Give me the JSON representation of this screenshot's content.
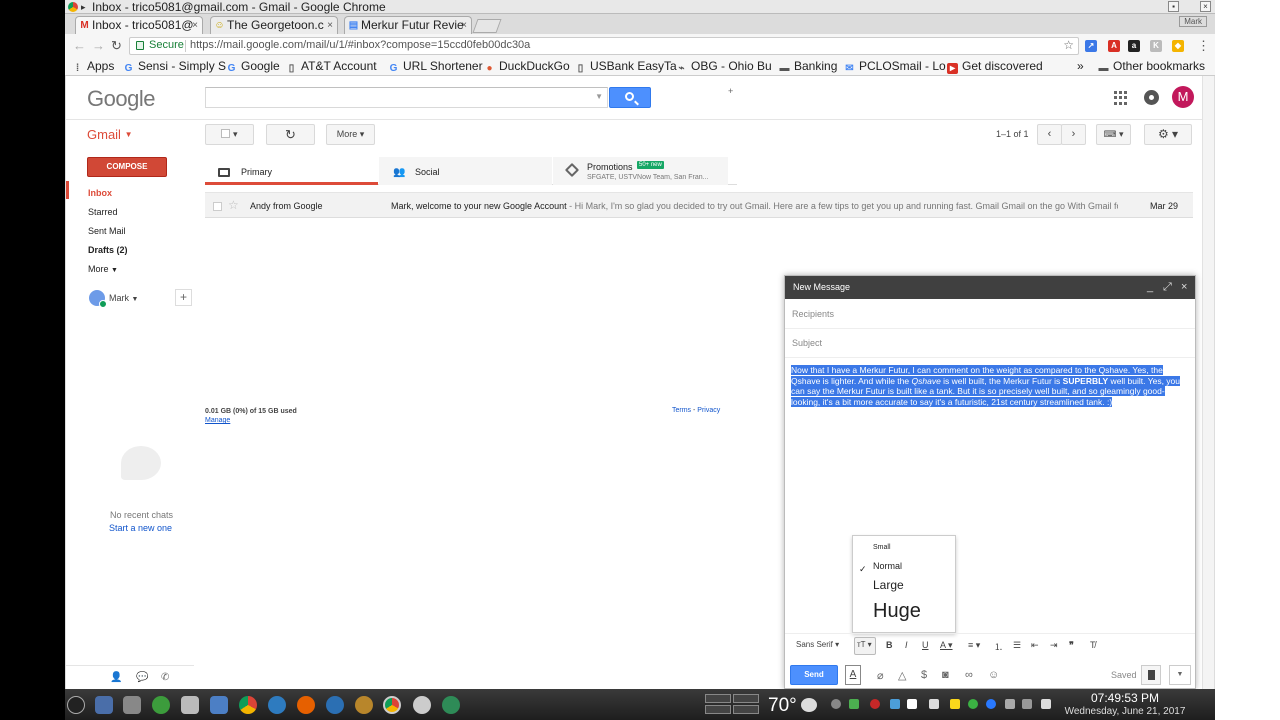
{
  "window": {
    "title": "Inbox - trico5081@gmail.com - Gmail - Google Chrome",
    "profile": "Mark"
  },
  "tabs": [
    {
      "label": "Inbox - trico5081@",
      "favicon": "gmail-icon",
      "active": true
    },
    {
      "label": "The Georgetoon.c",
      "favicon": "georgetoon-icon",
      "active": false
    },
    {
      "label": "Merkur Futur Revie",
      "favicon": "document-icon",
      "active": false
    }
  ],
  "omnibox": {
    "secure_label": "Secure",
    "url": "https://mail.google.com/mail/u/1/#inbox?compose=15ccd0feb00dc30a"
  },
  "bookmarks": [
    {
      "label": "Apps",
      "icon": "apps-grid-icon"
    },
    {
      "label": "Sensi - Simply S",
      "icon": "google-icon"
    },
    {
      "label": "Google",
      "icon": "google-icon"
    },
    {
      "label": "AT&T Account",
      "icon": "page-icon"
    },
    {
      "label": "URL Shortener",
      "icon": "google-icon"
    },
    {
      "label": "DuckDuckGo",
      "icon": "duckduckgo-icon"
    },
    {
      "label": "USBank EasyTa",
      "icon": "page-icon"
    },
    {
      "label": "OBG - Ohio Bu",
      "icon": "link-icon"
    },
    {
      "label": "Banking",
      "icon": "folder-icon"
    },
    {
      "label": "PCLOSmail - Lo",
      "icon": "mail-icon"
    },
    {
      "label": "Get discovered",
      "icon": "youtube-icon"
    }
  ],
  "bookmarks_overflow": "»",
  "other_bookmarks": "Other bookmarks",
  "gmail": {
    "logo": "Google",
    "app_label": "Gmail",
    "avatar_letter": "M",
    "toolbar": {
      "more_label": "More",
      "pager": "1–1 of 1"
    },
    "compose_label": "COMPOSE",
    "nav": [
      {
        "label": "Inbox"
      },
      {
        "label": "Starred"
      },
      {
        "label": "Sent Mail"
      },
      {
        "label": "Drafts (2)"
      },
      {
        "label": "More"
      }
    ],
    "hangouts": {
      "user": "Mark",
      "no_chats": "No recent chats",
      "start_new": "Start a new one"
    },
    "category_tabs": [
      {
        "label": "Primary"
      },
      {
        "label": "Social"
      },
      {
        "label": "Promotions",
        "badge": "50+ new",
        "sub": "SFGATE, USTVNow Team, San Fran..."
      }
    ],
    "messages": [
      {
        "from": "Andy from Google",
        "subject": "Mark, welcome to your new Google Account",
        "snippet": " - Hi Mark, I'm so glad you decided to try out Gmail. Here are a few tips to get you up and running fast. Gmail Gmail on the go With Gmail for",
        "date": "Mar 29"
      }
    ],
    "storage": {
      "usage": "0.01 GB (0%) of 15 GB used",
      "manage": "Manage"
    },
    "footer": {
      "terms": "Terms",
      "sep": " - ",
      "privacy": "Privacy"
    }
  },
  "compose": {
    "title": "New Message",
    "recipients_placeholder": "Recipients",
    "subject_placeholder": "Subject",
    "body": {
      "p1": "Now that I have a Merkur Futur, I can comment on the weight as compared to the Qshave.  Yes, the Qshave is lighter.  And while the ",
      "p1_italic": "Qshave",
      "p2": " is well built, the Merkur Futur is ",
      "p2_bold": "SUPERBLY",
      "p3": " well built.  Yes, you can say the Merkur Futur is built like a tank.  But it is so precisely well built, and so gleamingly good-looking, it's a bit more accurate to say it's a futuristic, 21st century streamlined tank. :)"
    },
    "size_menu": {
      "selected": "Normal",
      "options": [
        "Small",
        "Normal",
        "Large",
        "Huge"
      ]
    },
    "font": "Sans Serif",
    "send_label": "Send",
    "saved_label": "Saved"
  },
  "taskbar": {
    "temperature": "70°",
    "time": "07:49:53 PM",
    "date": "Wednesday, June 21, 2017"
  }
}
